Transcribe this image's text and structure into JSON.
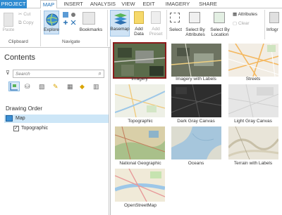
{
  "tabs": [
    {
      "label": "PROJECT"
    },
    {
      "label": "MAP"
    },
    {
      "label": "INSERT"
    },
    {
      "label": "ANALYSIS"
    },
    {
      "label": "VIEW"
    },
    {
      "label": "EDIT"
    },
    {
      "label": "IMAGERY"
    },
    {
      "label": "SHARE"
    }
  ],
  "clipboard": {
    "paste": "Paste",
    "cut": "Cut",
    "copy": "Copy",
    "group": "Clipboard"
  },
  "navigate": {
    "explore": "Explore",
    "bookmarks": "Bookmarks",
    "group": "Navigate"
  },
  "layer": {
    "basemap": "Basemap",
    "add_data_1": "Add",
    "add_data_2": "Data",
    "add_preset_1": "Add",
    "add_preset_2": "Preset"
  },
  "selection": {
    "select": "Select",
    "select_by_attr_1": "Select By",
    "select_by_attr_2": "Attributes",
    "select_by_loc_1": "Select By",
    "select_by_loc_2": "Location",
    "attributes": "Attributes",
    "clear": "Clear"
  },
  "inquiry": {
    "label": "Infogr"
  },
  "contents": {
    "title": "Contents",
    "search_placeholder": "Search",
    "drawing_order": "Drawing Order",
    "map_item": "Map",
    "layer_item": "Topographic"
  },
  "basemaps": [
    {
      "label": "Imagery",
      "selected": true
    },
    {
      "label": "Imagery with Labels"
    },
    {
      "label": "Streets"
    },
    {
      "label": "Topographic"
    },
    {
      "label": "Dark Gray Canvas"
    },
    {
      "label": "Light Gray Canvas"
    },
    {
      "label": "National Geographic"
    },
    {
      "label": "Oceans"
    },
    {
      "label": "Terrain with Labels"
    },
    {
      "label": "OpenStreetMap"
    }
  ],
  "colors": {
    "accent": "#2e8bd1",
    "selected_border": "#8b1a1a",
    "tab_active_text": "#1b6fb8"
  }
}
